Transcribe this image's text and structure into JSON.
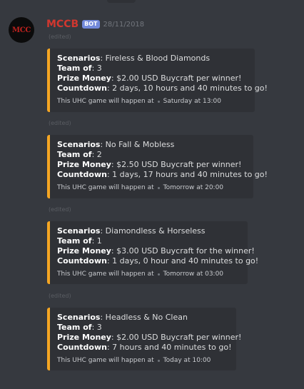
{
  "message": {
    "username": "MCCB",
    "bot_tag": "BOT",
    "timestamp": "28/11/2018",
    "avatar_text": "MCC"
  },
  "embeds": [
    {
      "edited": "(edited)",
      "scenarios_label": "Scenarios",
      "scenarios": ": Fireless & Blood Diamonds",
      "team_label": "Team of",
      "team": ": 3",
      "prize_label": "Prize Money",
      "prize": ": $2.00 USD Buycraft per winner!",
      "countdown_label": "Countdown",
      "countdown": ": 2 days, 10 hours and 40 minutes to go!",
      "footer_text": "This UHC game will happen at",
      "footer_time": "Saturday at 13:00"
    },
    {
      "edited": "(edited)",
      "scenarios_label": "Scenarios",
      "scenarios": ": No Fall & Mobless",
      "team_label": "Team of",
      "team": ": 2",
      "prize_label": "Prize Money",
      "prize": ": $2.50 USD Buycraft per winner!",
      "countdown_label": "Countdown",
      "countdown": ": 1 days, 17 hours and 40 minutes to go!",
      "footer_text": "This UHC game will happen at",
      "footer_time": "Tomorrow at 20:00"
    },
    {
      "edited": "(edited)",
      "scenarios_label": "Scenarios",
      "scenarios": ": Diamondless & Horseless",
      "team_label": "Team of",
      "team": ": 1",
      "prize_label": "Prize Money",
      "prize": ": $3.00 USD Buycraft for the winner!",
      "countdown_label": "Countdown",
      "countdown": ": 1 days, 0 hour and 40 minutes to go!",
      "footer_text": "This UHC game will happen at",
      "footer_time": "Tomorrow at 03:00"
    },
    {
      "edited": "(edited)",
      "scenarios_label": "Scenarios",
      "scenarios": ": Headless & No Clean",
      "team_label": "Team of",
      "team": ": 3",
      "prize_label": "Prize Money",
      "prize": ": $2.00 USD Buycraft per winner!",
      "countdown_label": "Countdown",
      "countdown": ": 7 hours and 40 minutes to go!",
      "footer_text": "This UHC game will happen at",
      "footer_time": "Today at 10:00"
    }
  ],
  "colors": {
    "background": "#36393f",
    "embed_background": "#2f3136",
    "embed_accent": "#f5a623",
    "username": "#d1372f",
    "bot_tag": "#7289da"
  }
}
